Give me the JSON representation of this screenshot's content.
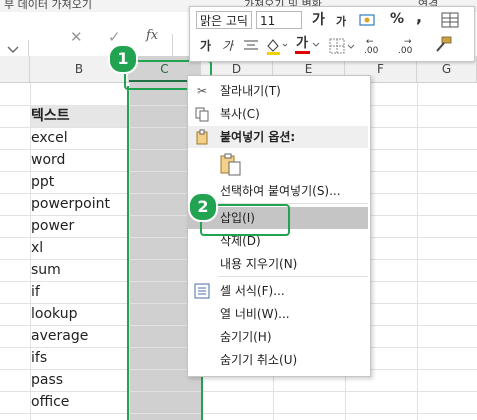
{
  "ribbon": {
    "left_text": "부 데이터 가져오기",
    "mid_text": "가져오기 및 변환",
    "right_text": "연결"
  },
  "formula_bar": {
    "cancel_glyph": "✕",
    "enter_glyph": "✓",
    "fx_label": "fx"
  },
  "columns": [
    "B",
    "C",
    "D",
    "E",
    "F",
    "G"
  ],
  "selected_column": "C",
  "cells_b": [
    "텍스트",
    "excel",
    "word",
    "ppt",
    "powerpoint",
    "power",
    "xl",
    "sum",
    "if",
    "lookup",
    "average",
    "ifs",
    "pass",
    "office"
  ],
  "mini_toolbar": {
    "font_name": "맑은 고딕",
    "font_size": "11",
    "grow_font": "가",
    "shrink_font": "가",
    "percent": "%",
    "comma": ",",
    "bold": "가",
    "italic": "가",
    "font_color_glyph": "가",
    "increase_decimal": ".00",
    "decrease_decimal": ".00"
  },
  "context_menu": {
    "items": [
      {
        "label": "잘라내기(T)",
        "icon": "scissors-icon"
      },
      {
        "label": "복사(C)",
        "icon": "copy-icon"
      },
      {
        "label": "붙여넣기 옵션:",
        "icon": "clipboard-icon"
      },
      {
        "label": "선택하여 붙여넣기(S)...",
        "icon": ""
      },
      {
        "label": "삽입(I)",
        "icon": ""
      },
      {
        "label": "삭제(D)",
        "icon": ""
      },
      {
        "label": "내용 지우기(N)",
        "icon": ""
      },
      {
        "label": "셀 서식(F)...",
        "icon": "format-cells-icon"
      },
      {
        "label": "열 너비(W)...",
        "icon": ""
      },
      {
        "label": "숨기기(H)",
        "icon": ""
      },
      {
        "label": "숨기기 취소(U)",
        "icon": ""
      }
    ]
  },
  "annotations": {
    "step1": "1",
    "step2": "2"
  },
  "colors": {
    "accent_green": "#22a352",
    "selection_gray": "#d0d0d0",
    "excel_green": "#217346"
  }
}
